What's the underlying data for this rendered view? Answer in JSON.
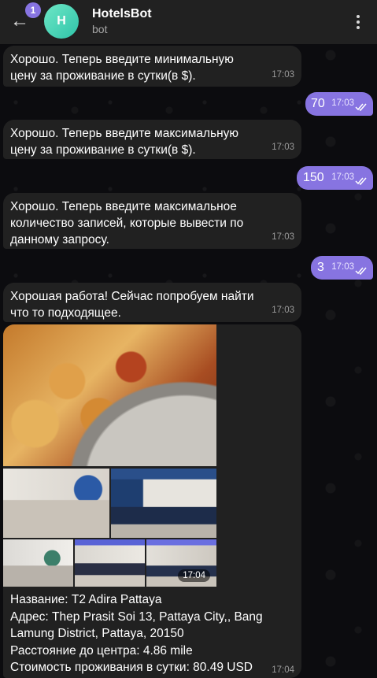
{
  "header": {
    "back_label": "←",
    "unread_count": "1",
    "avatar_letter": "H",
    "title": "HotelsBot",
    "subtitle": "bot"
  },
  "messages": [
    {
      "text": "Хорошо. Теперь введите минимальную цену за проживание в сутки(в $).",
      "time": "17:03"
    },
    {
      "text": "70",
      "time": "17:03"
    },
    {
      "text": "Хорошо. Теперь введите максимальную цену за проживание в сутки(в $).",
      "time": "17:03"
    },
    {
      "text": "150",
      "time": "17:03"
    },
    {
      "text": "Хорошо. Теперь введите максимальное количество записей, которые вывести по данному запросу.",
      "time": "17:03"
    },
    {
      "text": "3",
      "time": "17:03"
    },
    {
      "text": "Хорошая работа! Сейчас попробуем найти что то подходящее.",
      "time": "17:03"
    }
  ],
  "album": {
    "photo_time": "17:04",
    "caption_lines": [
      "Название: T2 Adira Pattaya",
      "Адрес: Thep Prasit Soi 13, Pattaya City,, Bang",
      "Lamung District, Pattaya, 20150",
      "Расстояние до центра: 4.86 mile",
      "Стоимость проживания в сутки: 80.49 USD"
    ],
    "caption_time": "17:04"
  },
  "colors": {
    "accent": "#8774e1",
    "bubble_incoming": "#212121",
    "header_bg": "#212121",
    "avatar": "#2fc4a9"
  }
}
